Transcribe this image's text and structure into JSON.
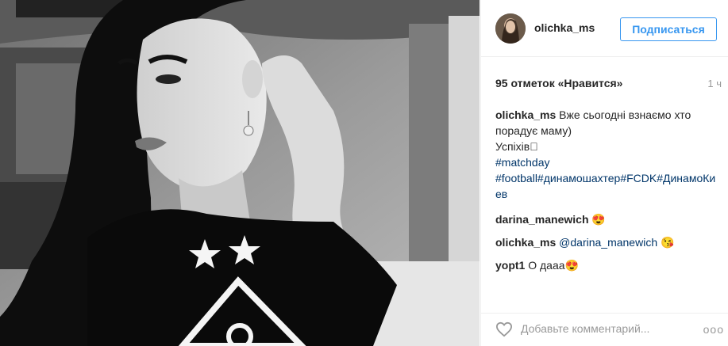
{
  "post": {
    "username": "olichka_ms",
    "follow_label": "Подписаться",
    "likes": "95 отметок «Нравится»",
    "time": "1 ч",
    "caption": {
      "author": "olichka_ms",
      "line1": "Вже сьогодні взнаємо хто порадує маму)",
      "line2": "Успіхів🏻",
      "tag1": "#matchday",
      "tags2": "#football#динамошахтер#FCDK#ДинамоКиев"
    },
    "comments": [
      {
        "author": "darina_manewich",
        "text": "😍",
        "mention": ""
      },
      {
        "author": "olichka_ms",
        "text": " 😘",
        "mention": "@darina_manewich"
      },
      {
        "author": "yopt1",
        "text": "О дааа😍",
        "mention": ""
      }
    ],
    "add_comment_placeholder": "Добавьте комментарий...",
    "more_label": "ooo"
  },
  "icons": {
    "like": "heart-icon",
    "more": "more-options-icon"
  }
}
